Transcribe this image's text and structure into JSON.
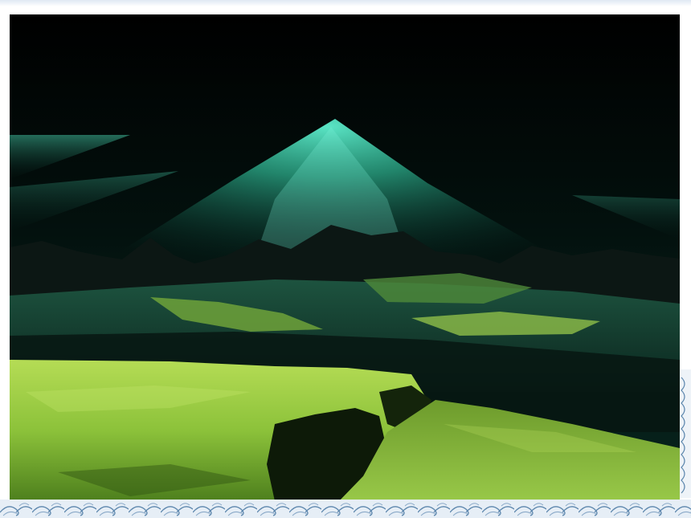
{
  "slide": {
    "photo": {
      "subject": "landscape-photo",
      "palette": {
        "sky": "#010403",
        "light_beam": "#3fe0b8",
        "mountains": "#0a1412",
        "grass_light": "#a8d64a",
        "grass_dark": "#3c6a16"
      }
    },
    "border": {
      "pattern": "wave-pattern",
      "color": "#5c86ad",
      "background": "#e6eef6"
    }
  }
}
